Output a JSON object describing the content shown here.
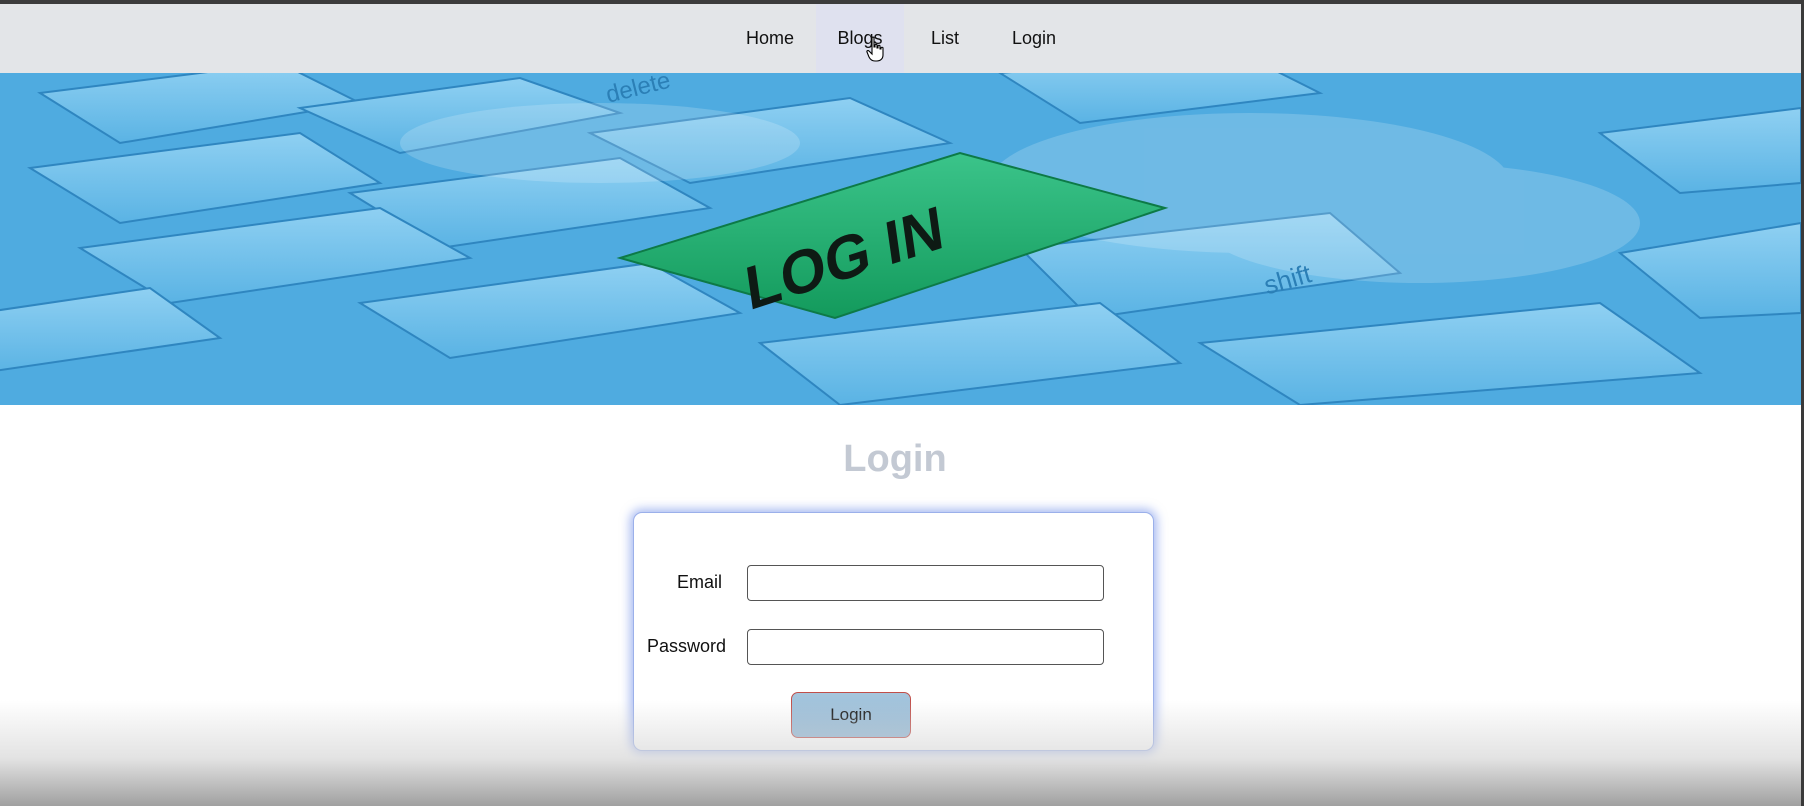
{
  "nav": {
    "items": [
      {
        "label": "Home"
      },
      {
        "label": "Blogs"
      },
      {
        "label": "List"
      },
      {
        "label": "Login"
      }
    ],
    "hovered": "Blogs"
  },
  "hero": {
    "key_text": "LOG IN",
    "keycap_text_shift": "shift",
    "keycap_text_delete": "delete",
    "icon": "keyboard-banner-image",
    "colors": {
      "sky": "#4aa8df",
      "key_green": "#20a86a"
    }
  },
  "form": {
    "title": "Login",
    "email_label": "Email",
    "email_value": "",
    "password_label": "Password",
    "password_value": "",
    "submit_label": "Login"
  }
}
